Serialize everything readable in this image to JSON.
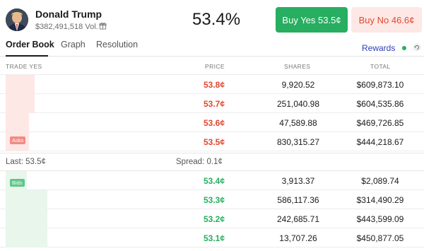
{
  "market": {
    "name": "Donald Trump",
    "volume": "$382,491,518 Vol.",
    "chance": "53.4%"
  },
  "actions": {
    "buy_yes": "Buy Yes 53.5¢",
    "buy_no": "Buy No 46.6¢"
  },
  "tabs": [
    "Order Book",
    "Graph",
    "Resolution"
  ],
  "rewards_label": "Rewards",
  "columns": {
    "trade": "TRADE YES",
    "price": "PRICE",
    "shares": "SHARES",
    "total": "TOTAL"
  },
  "asks_label": "Asks",
  "bids_label": "Bids",
  "asks": [
    {
      "price": "53.8¢",
      "shares": "9,920.52",
      "total": "$609,873.10",
      "depth": 0.07
    },
    {
      "price": "53.7¢",
      "shares": "251,040.98",
      "total": "$604,535.86",
      "depth": 0.07
    },
    {
      "price": "53.6¢",
      "shares": "47,589.88",
      "total": "$469,726.85",
      "depth": 0.055
    },
    {
      "price": "53.5¢",
      "shares": "830,315.27",
      "total": "$444,218.67",
      "depth": 0.055
    }
  ],
  "spread_row": {
    "last": "Last: 53.5¢",
    "spread": "Spread: 0.1¢"
  },
  "bids": [
    {
      "price": "53.4¢",
      "shares": "3,913.37",
      "total": "$2,089.74",
      "depth": 0.05
    },
    {
      "price": "53.3¢",
      "shares": "586,117.36",
      "total": "$314,490.29",
      "depth": 0.1
    },
    {
      "price": "53.2¢",
      "shares": "242,685.71",
      "total": "$443,599.09",
      "depth": 0.1
    },
    {
      "price": "53.1¢",
      "shares": "13,707.26",
      "total": "$450,877.05",
      "depth": 0.1
    }
  ],
  "colors": {
    "yes_green": "#27ae60",
    "no_red": "#e0482e",
    "ask_bg": "#fde8e6",
    "bid_bg": "#e8f6ec",
    "rewards_blue": "#2d3bb8"
  },
  "icons": {
    "avatar": "candidate-portrait",
    "gift": "gift-icon",
    "refresh": "refresh-icon"
  }
}
